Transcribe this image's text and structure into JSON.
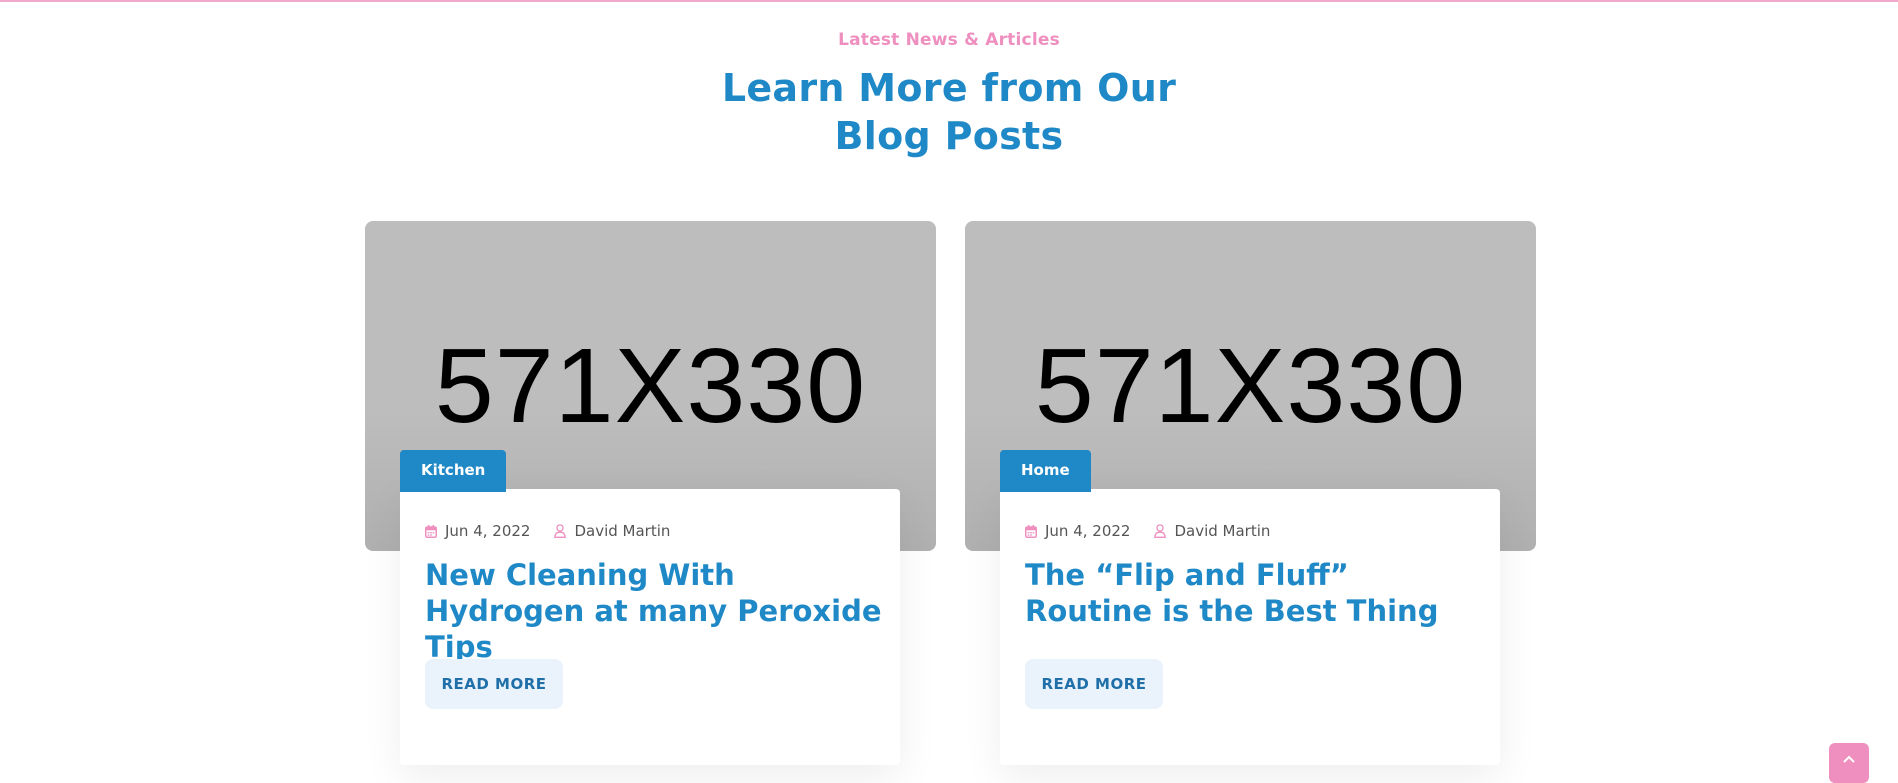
{
  "section": {
    "subtitle": "Latest News & Articles",
    "title_line1": "Learn More from Our",
    "title_line2": "Blog Posts"
  },
  "posts": [
    {
      "image_placeholder": "571X330",
      "category": "Kitchen",
      "date": "Jun 4, 2022",
      "author": "David Martin",
      "title": "New Cleaning With Hydrogen at many Peroxide Tips",
      "read_more": "READ MORE"
    },
    {
      "image_placeholder": "571X330",
      "category": "Home",
      "date": "Jun 4, 2022",
      "author": "David Martin",
      "title": "The “Flip and Fluff” Routine is the Best Thing",
      "read_more": "READ MORE"
    }
  ],
  "icons": {
    "date": "calendar-icon",
    "author": "user-icon",
    "scroll_top": "chevron-up-icon"
  },
  "colors": {
    "accent_blue": "#1f88c6",
    "accent_pink": "#ee8fbf",
    "button_bg": "#eaf3fc",
    "image_placeholder_bg": "#bdbdbd"
  }
}
